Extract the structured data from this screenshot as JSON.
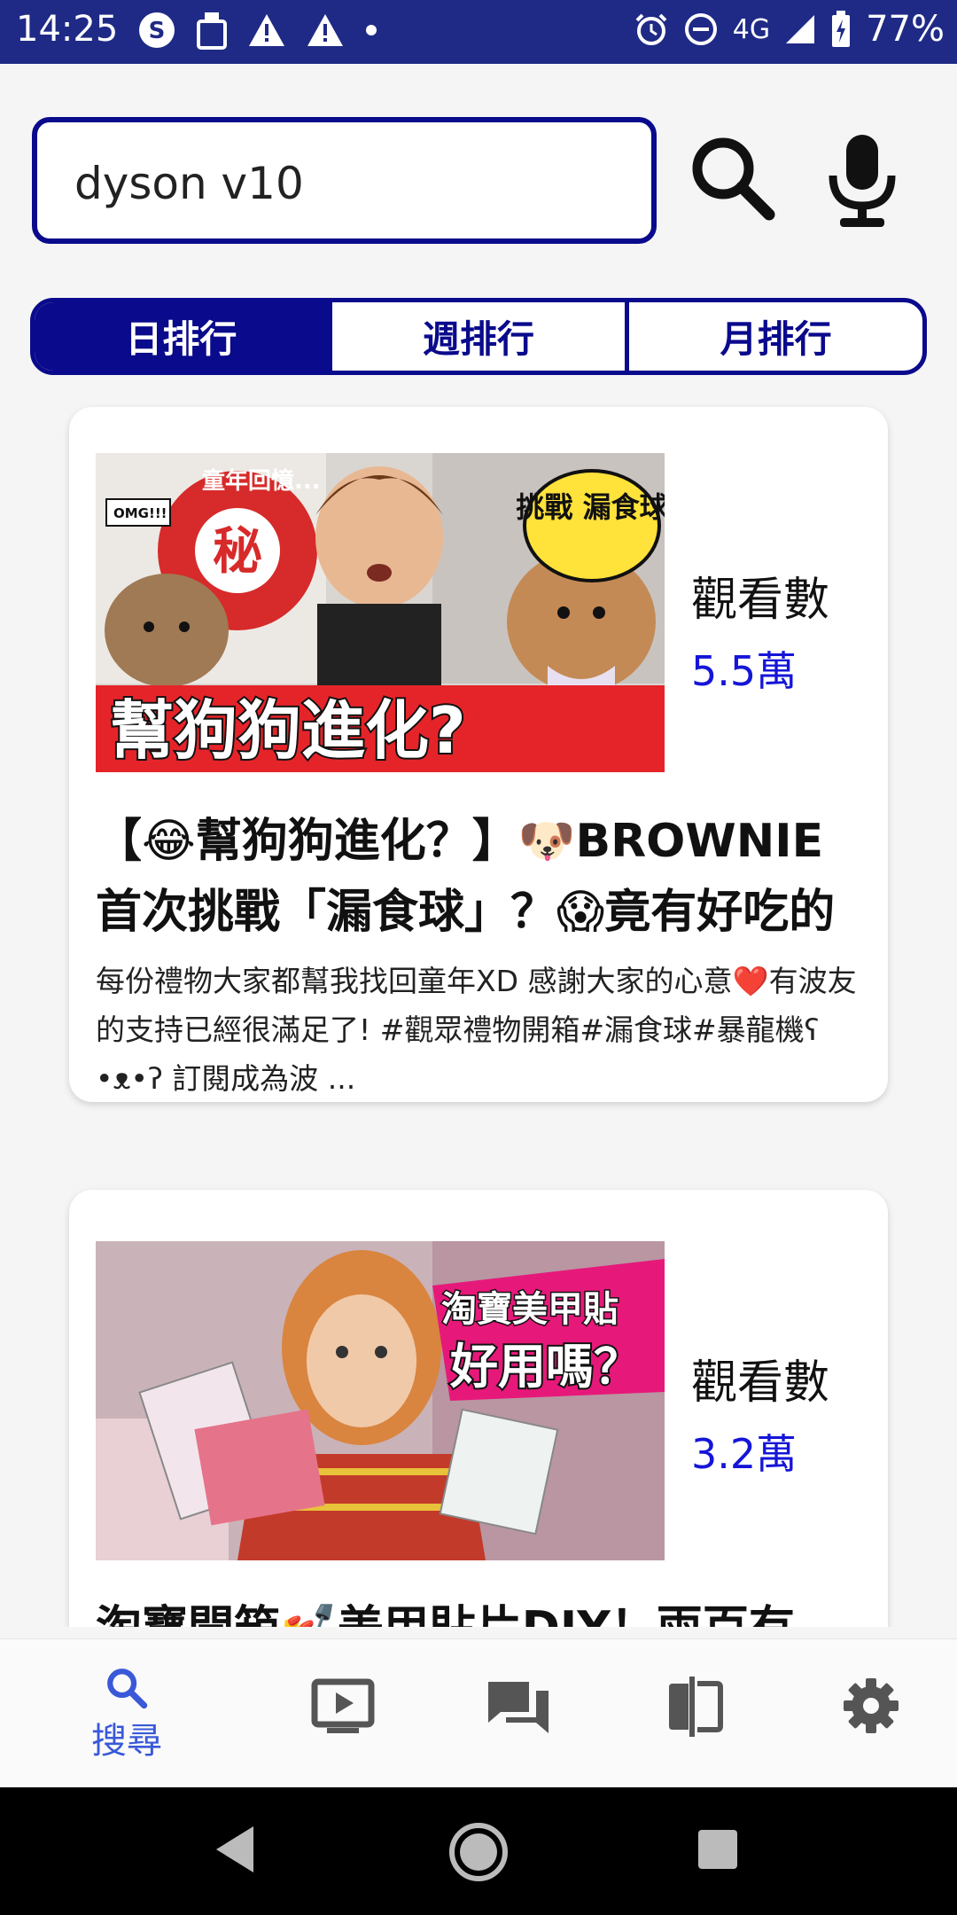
{
  "status_bar": {
    "time": "14:25",
    "network": "4G",
    "battery": "77%",
    "icons": [
      "s-app-icon",
      "clipboard-icon",
      "warning-icon",
      "warning-icon",
      "dot-icon",
      "alarm-icon",
      "dnd-icon",
      "signal-icon",
      "battery-icon"
    ]
  },
  "search": {
    "query": "dyson v10"
  },
  "tabs": [
    "日排行",
    "週排行",
    "月排行"
  ],
  "videos": [
    {
      "views_label": "觀看數",
      "views": "5.5萬",
      "title": "【😂幫狗狗進化？】🐶BROWNIE首次挑戰「漏食球」？😱竟有好吃的",
      "description": "每份禮物大家都幫我找回童年XD 感謝大家的心意❤️有波友的支持已經很滿足了! #觀眾禮物開箱#漏食球#暴龍機ʕ •ᴥ•ʔ 訂閱成為波 ...",
      "thumb_text": {
        "bottom": "幫狗狗進化?",
        "badge": "秘",
        "arc": "童年回憶...",
        "bubble": "挑戰 漏食球",
        "omg": "OMG!!!"
      }
    },
    {
      "views_label": "觀看數",
      "views": "3.2萬",
      "title": "淘寶開箱💅美甲貼片DIY！兩百有",
      "thumb_text": {
        "line1": "淘寶美甲貼",
        "line2": "好用嗎？"
      }
    }
  ],
  "bottom_nav": {
    "items": [
      {
        "icon": "search-icon",
        "label": "搜尋",
        "active": true
      },
      {
        "icon": "video-icon"
      },
      {
        "icon": "chat-icon"
      },
      {
        "icon": "compare-icon"
      },
      {
        "icon": "gear-icon"
      }
    ]
  },
  "colors": {
    "primary": "#0a0a8c",
    "status_bar": "#1f2a86",
    "views": "#1515d8",
    "nav_active": "#3a59d8"
  }
}
